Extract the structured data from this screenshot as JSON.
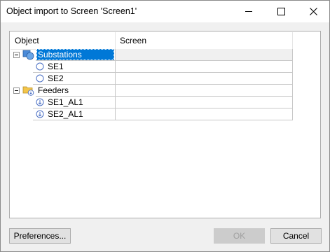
{
  "window": {
    "title": "Object import to Screen 'Screen1'"
  },
  "table": {
    "headers": {
      "object": "Object",
      "screen": "Screen"
    },
    "rows": [
      {
        "label": "Substations",
        "screen": "",
        "level": 0,
        "icon": "substation-group-icon",
        "expanded": true,
        "selected": true
      },
      {
        "label": "SE1",
        "screen": "",
        "level": 1,
        "icon": "substation-icon"
      },
      {
        "label": "SE2",
        "screen": "",
        "level": 1,
        "icon": "substation-icon"
      },
      {
        "label": "Feeders",
        "screen": "",
        "level": 0,
        "icon": "feeder-folder-icon",
        "expanded": true
      },
      {
        "label": "SE1_AL1",
        "screen": "",
        "level": 1,
        "icon": "feeder-icon"
      },
      {
        "label": "SE2_AL1",
        "screen": "",
        "level": 1,
        "icon": "feeder-icon"
      }
    ]
  },
  "buttons": {
    "preferences": "Preferences...",
    "ok": "OK",
    "cancel": "Cancel"
  },
  "colors": {
    "selection": "#0078d7",
    "window_bg": "#f0f0f0"
  }
}
